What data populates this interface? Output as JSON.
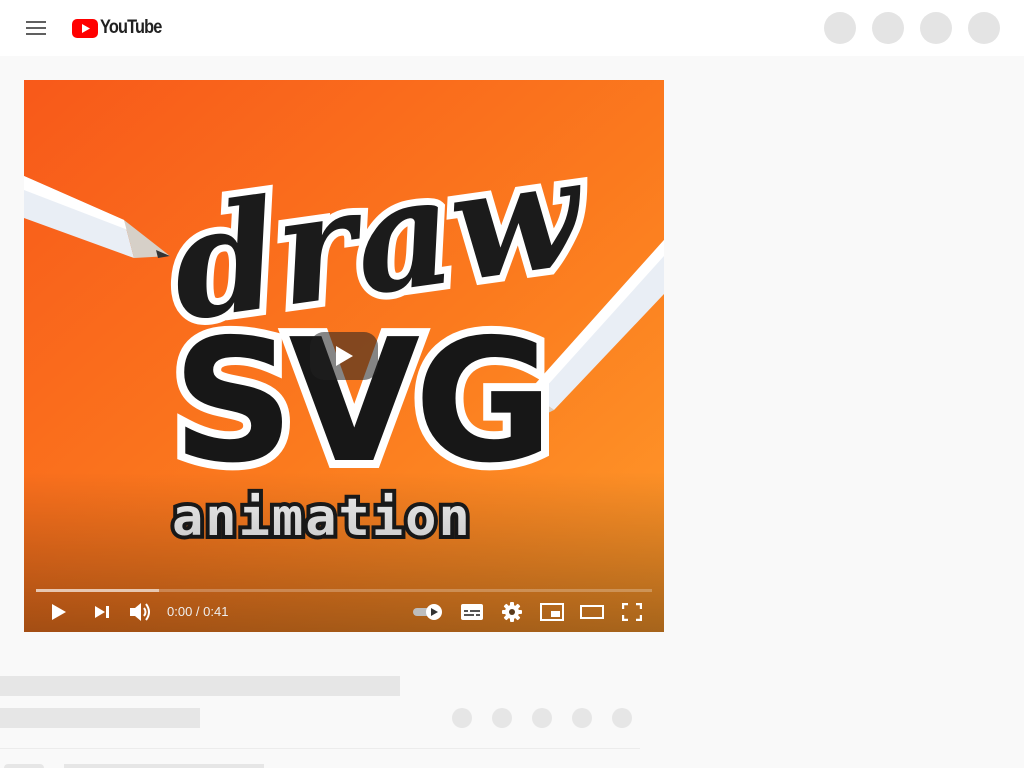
{
  "masthead": {
    "logo_text": "YouTube",
    "brand_color": "#ff0000",
    "icons": [
      "menu-icon",
      "youtube-logo-icon"
    ],
    "placeholder_buttons": 4
  },
  "video": {
    "thumbnail_text": {
      "line1": "draw",
      "line2": "SVG",
      "line3": "animation"
    },
    "background_colors": [
      "#f8591a",
      "#ff9a2a"
    ],
    "time_display": "0:00 / 0:41",
    "current_time": "0:00",
    "duration": "0:41",
    "buffered_fraction": 0.2,
    "played_fraction": 0.0,
    "control_icons": [
      "play-icon",
      "next-icon",
      "volume-icon",
      "autoplay-toggle-icon",
      "subtitles-icon",
      "settings-icon",
      "miniplayer-icon",
      "theater-mode-icon",
      "fullscreen-icon"
    ]
  }
}
